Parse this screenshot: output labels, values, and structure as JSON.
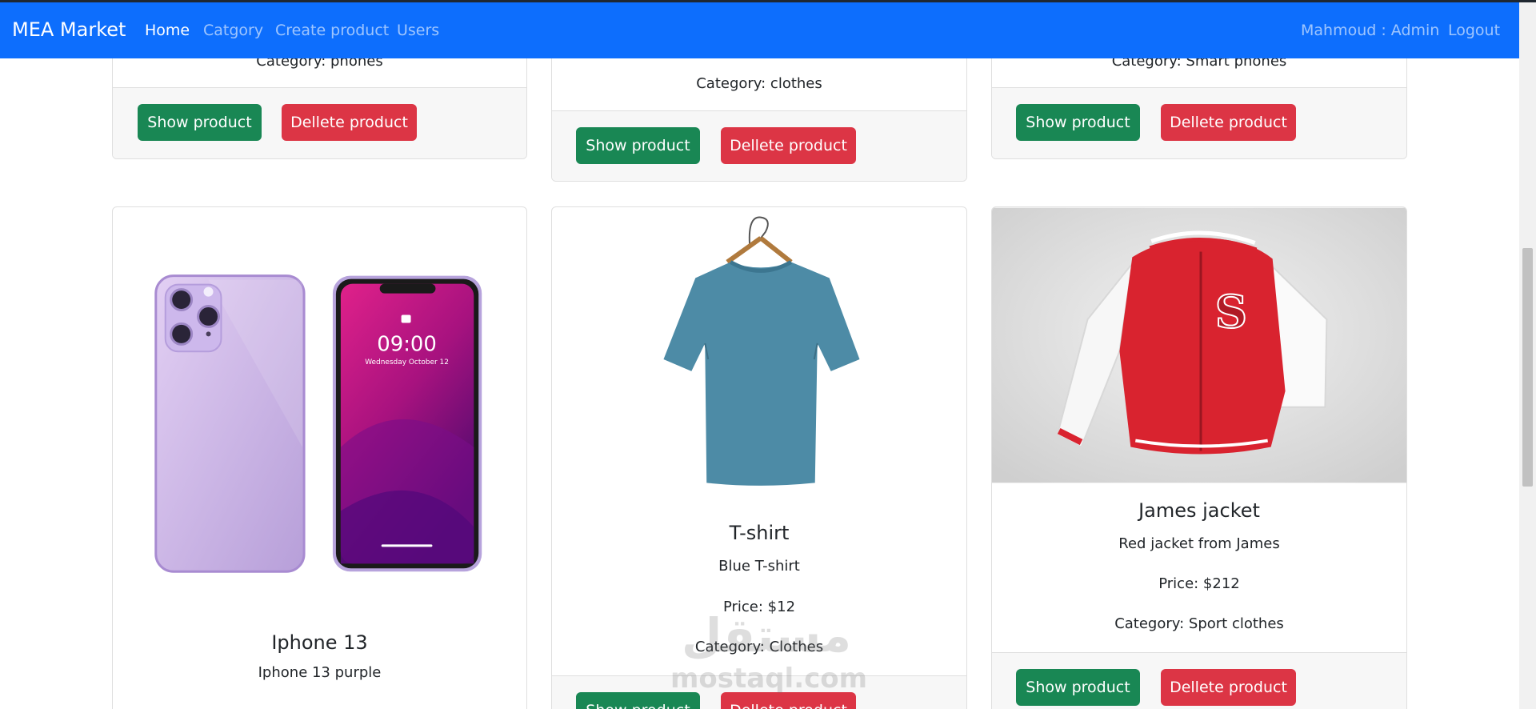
{
  "navbar": {
    "brand": "MEA Market",
    "links": [
      "Home",
      "Catgory",
      "Create product",
      "Users"
    ],
    "user_label": "Mahmoud : Admin",
    "logout": "Logout"
  },
  "colors": {
    "navbar_bg": "#0d6efd",
    "show_button": "#198754",
    "delete_button": "#dc3545",
    "card_footer": "#f7f7f7"
  },
  "buttons": {
    "show": "Show product",
    "delete": "Dellete product"
  },
  "products_partial": [
    {
      "category": "Category: phones"
    },
    {
      "category": "Category: clothes"
    },
    {
      "category": "Category: Smart phones"
    }
  ],
  "products": [
    {
      "title": "Iphone 13",
      "description": "Iphone 13 purple",
      "image_icon": "iphone-image"
    },
    {
      "title": "T-shirt",
      "description": "Blue T-shirt",
      "price": "Price: $12",
      "category": "Category: Clothes",
      "image_icon": "tshirt-image"
    },
    {
      "title": "James jacket",
      "description": "Red jacket from James",
      "price": "Price: $212",
      "category": "Category: Sport clothes",
      "image_icon": "jacket-image"
    }
  ],
  "watermark": {
    "arabic": "مستقل",
    "latin": "mostaql.com"
  }
}
